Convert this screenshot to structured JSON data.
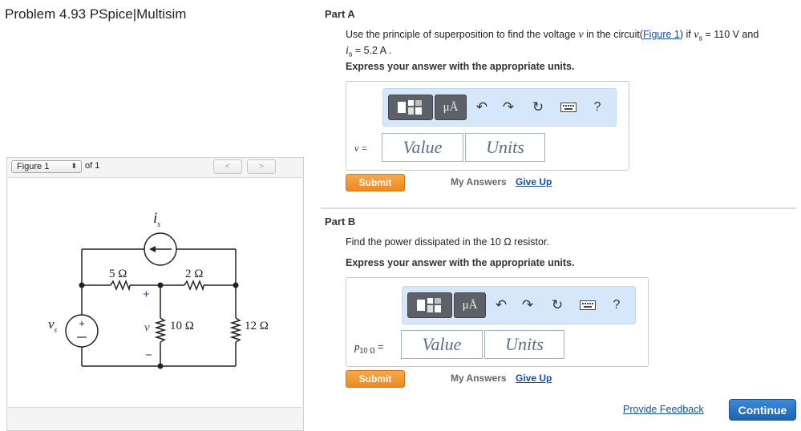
{
  "problem_title": "Problem 4.93 PSpice|Multisim",
  "figure_panel": {
    "selected": "Figure 1",
    "of_label": "of 1",
    "prev": "<",
    "next": ">"
  },
  "circuit": {
    "is_label": "i",
    "is_sub": "s",
    "vs_label": "v",
    "vs_sub": "s",
    "r1": "5 Ω",
    "r2": "2 Ω",
    "r3": "10 Ω",
    "r4": "12 Ω",
    "v_label": "v",
    "plus": "+",
    "minus": "−"
  },
  "partA": {
    "heading": "Part A",
    "q_pre": "Use the principle of superposition to find the voltage ",
    "q_v": "v",
    "q_mid": " in the circuit(",
    "q_link": "Figure 1",
    "q_post": ") if ",
    "q_vs": "v",
    "q_vs_sub": "s",
    "q_vs_val": " = 110 V and",
    "q_is": "i",
    "q_is_sub": "s",
    "q_is_val": " = 5.2 A .",
    "instruction": "Express your answer with the appropriate units.",
    "var_label": "v =",
    "value_placeholder": "Value",
    "units_placeholder": "Units",
    "submit": "Submit",
    "my_answers": "My Answers",
    "give_up": "Give Up"
  },
  "partB": {
    "heading": "Part B",
    "q": "Find the power dissipated in the 10 Ω resistor.",
    "instruction": "Express your answer with the appropriate units.",
    "var_label": "p",
    "var_sub": "10 Ω",
    "var_eq": " =",
    "value_placeholder": "Value",
    "units_placeholder": "Units",
    "submit": "Submit",
    "my_answers": "My Answers",
    "give_up": "Give Up"
  },
  "toolbar": {
    "mu_label": "μÅ",
    "undo": "↶",
    "redo": "↷",
    "reset": "↻",
    "help": "?",
    "icons": [
      "templates-icon",
      "units-icon",
      "undo-icon",
      "redo-icon",
      "reset-icon",
      "keyboard-icon",
      "help-icon"
    ]
  },
  "footer": {
    "feedback": "Provide Feedback",
    "continue": "Continue"
  }
}
